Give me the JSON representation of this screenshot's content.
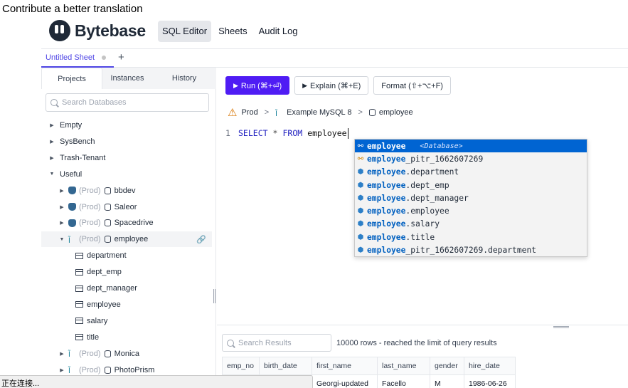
{
  "banner": {
    "text": "Contribute a better translation"
  },
  "header": {
    "brand": "Bytebase",
    "nav": [
      {
        "label": "SQL Editor",
        "active": true
      },
      {
        "label": "Sheets",
        "active": false
      },
      {
        "label": "Audit Log",
        "active": false
      }
    ]
  },
  "tabs": {
    "sheet_label": "Untitled Sheet",
    "add_label": "+"
  },
  "sidebar": {
    "tabs": [
      "Projects",
      "Instances",
      "History"
    ],
    "search_placeholder": "Search Databases",
    "tree": [
      {
        "label": "Empty",
        "caret": "▶",
        "indent": 0,
        "kind": "project"
      },
      {
        "label": "SysBench",
        "caret": "▶",
        "indent": 0,
        "kind": "project"
      },
      {
        "label": "Trash-Tenant",
        "caret": "▶",
        "indent": 0,
        "kind": "project"
      },
      {
        "label": "Useful",
        "caret": "▼",
        "indent": 0,
        "kind": "project"
      },
      {
        "label": "bbdev",
        "env": "(Prod)",
        "caret": "▶",
        "indent": 1,
        "kind": "pg"
      },
      {
        "label": "Saleor",
        "env": "(Prod)",
        "caret": "▶",
        "indent": 1,
        "kind": "pg"
      },
      {
        "label": "Spacedrive",
        "env": "(Prod)",
        "caret": "▶",
        "indent": 1,
        "kind": "pg"
      },
      {
        "label": "employee",
        "env": "(Prod)",
        "caret": "▼",
        "indent": 1,
        "kind": "mysql",
        "selected": true
      },
      {
        "label": "department",
        "indent": 2,
        "kind": "table"
      },
      {
        "label": "dept_emp",
        "indent": 2,
        "kind": "table"
      },
      {
        "label": "dept_manager",
        "indent": 2,
        "kind": "table"
      },
      {
        "label": "employee",
        "indent": 2,
        "kind": "table"
      },
      {
        "label": "salary",
        "indent": 2,
        "kind": "table"
      },
      {
        "label": "title",
        "indent": 2,
        "kind": "table"
      },
      {
        "label": "Monica",
        "env": "(Prod)",
        "caret": "▶",
        "indent": 1,
        "kind": "mysql"
      },
      {
        "label": "PhotoPrism",
        "env": "(Prod)",
        "caret": "▶",
        "indent": 1,
        "kind": "mysql"
      }
    ]
  },
  "toolbar": {
    "run_label": "Run (⌘+⏎)",
    "explain_label": "Explain (⌘+E)",
    "format_label": "Format (⇧+⌥+F)"
  },
  "breadcrumb": {
    "environment": "Prod",
    "instance": "Example MySQL 8",
    "database": "employee",
    "separator": ">"
  },
  "editor": {
    "line_number": "1",
    "keyword_select": "SELECT",
    "star": "*",
    "keyword_from": "FROM",
    "identifier": "employee"
  },
  "autocomplete": {
    "items": [
      {
        "match": "employee",
        "rest": "",
        "detail": "<Database>",
        "kind": "database",
        "active": true
      },
      {
        "match": "employee",
        "rest": "_pitr_1662607269",
        "detail": "",
        "kind": "database",
        "active": false
      },
      {
        "match": "employee",
        "rest": ".department",
        "detail": "",
        "kind": "table",
        "active": false
      },
      {
        "match": "employee",
        "rest": ".dept_emp",
        "detail": "",
        "kind": "table",
        "active": false
      },
      {
        "match": "employee",
        "rest": ".dept_manager",
        "detail": "",
        "kind": "table",
        "active": false
      },
      {
        "match": "employee",
        "rest": ".employee",
        "detail": "",
        "kind": "table",
        "active": false
      },
      {
        "match": "employee",
        "rest": ".salary",
        "detail": "",
        "kind": "table",
        "active": false
      },
      {
        "match": "employee",
        "rest": ".title",
        "detail": "",
        "kind": "table",
        "active": false
      },
      {
        "match": "employee",
        "rest": "_pitr_1662607269.department",
        "detail": "",
        "kind": "table",
        "active": false
      }
    ]
  },
  "results": {
    "search_placeholder": "Search Results",
    "info": "10000 rows  -  reached the limit of query results",
    "columns": [
      "emp_no",
      "birth_date",
      "first_name",
      "last_name",
      "gender",
      "hire_date"
    ],
    "rows": [
      [
        "",
        "",
        "Georgi-updated",
        "Facello",
        "M",
        "1986-06-26"
      ]
    ]
  },
  "status_bar": {
    "text": "正在连接..."
  },
  "colors": {
    "accent": "#4f1cf4",
    "link": "#4f46e5",
    "suggest_active": "#0064d2",
    "warning": "#d97706"
  }
}
